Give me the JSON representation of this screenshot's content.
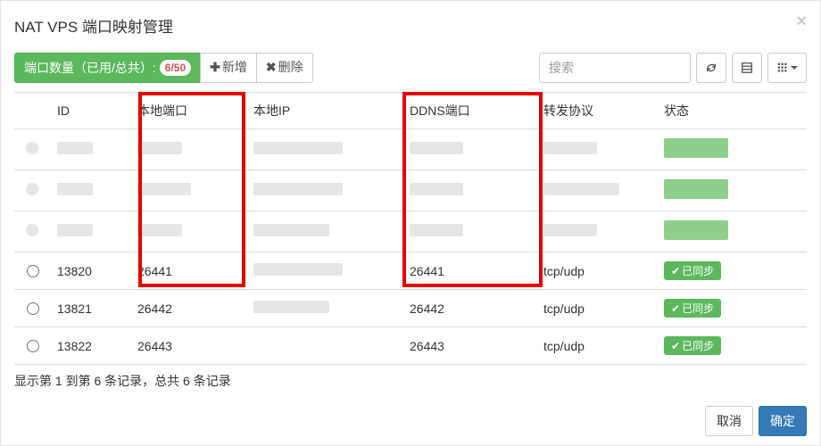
{
  "header": {
    "title": "NAT VPS 端口映射管理",
    "close": "×"
  },
  "toolbar": {
    "port_label": "端口数量（已用/总共）: ",
    "port_badge": "6/50",
    "add_label": "新增",
    "del_label": "删除",
    "search_placeholder": "搜索"
  },
  "columns": {
    "id": "ID",
    "local_port": "本地端口",
    "local_ip": "本地IP",
    "ddns_port": "DDNS端口",
    "protocol": "转发协议",
    "status": "状态"
  },
  "rows": [
    {
      "redacted": true
    },
    {
      "redacted": true
    },
    {
      "redacted": true
    },
    {
      "id": "13820",
      "local_port": "26441",
      "ddns_port": "26441",
      "protocol": "tcp/udp",
      "status": "已同步"
    },
    {
      "id": "13821",
      "local_port": "26442",
      "ddns_port": "26442",
      "protocol": "tcp/udp",
      "status": "已同步"
    },
    {
      "id": "13822",
      "local_port": "26443",
      "ddns_port": "26443",
      "protocol": "tcp/udp",
      "status": "已同步"
    }
  ],
  "pagination_text": "显示第 1 到第 6 条记录，总共 6 条记录",
  "footer": {
    "cancel": "取消",
    "ok": "确定"
  },
  "colors": {
    "green": "#5cb85c",
    "primary": "#337ab7",
    "red": "#d9534f"
  }
}
